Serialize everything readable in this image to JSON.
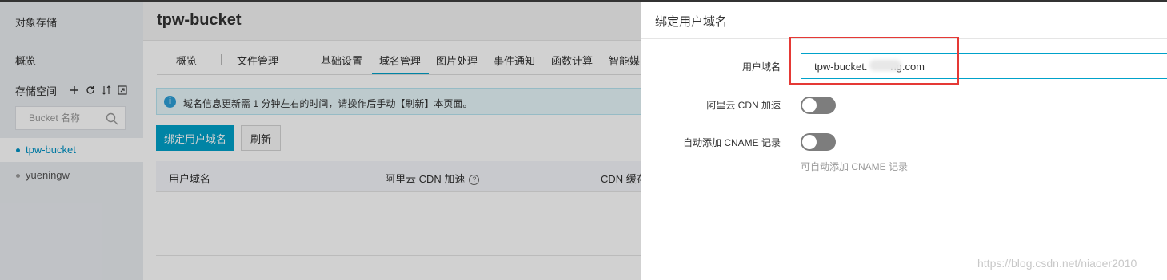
{
  "sidebar": {
    "title": "对象存储",
    "overview": "概览",
    "storage_label": "存储空间",
    "tools": [
      "add-icon",
      "refresh-icon",
      "sort-icon",
      "expand-icon"
    ],
    "search_placeholder": "Bucket 名称",
    "buckets": [
      {
        "name": "tpw-bucket",
        "active": true
      },
      {
        "name": "yueningw",
        "active": false
      }
    ]
  },
  "main": {
    "bucket_title": "tpw-bucket",
    "tabs": [
      "概览",
      "文件管理",
      "基础设置",
      "域名管理",
      "图片处理",
      "事件通知",
      "函数计算",
      "智能媒"
    ],
    "active_tab": "域名管理",
    "notice": "域名信息更新需 1 分钟左右的时间，请操作后手动【刷新】本页面。",
    "bind_button": "绑定用户域名",
    "refresh_button": "刷新",
    "table_headers": [
      "用户域名",
      "阿里云 CDN 加速",
      "CDN 缓存"
    ]
  },
  "panel": {
    "title": "绑定用户域名",
    "domain_label": "用户域名",
    "domain_value": "tpw-bucket.        ng.com",
    "cdn_label": "阿里云 CDN 加速",
    "cname_label": "自动添加 CNAME 记录",
    "cname_help": "可自动添加 CNAME 记录",
    "cdn_enabled": false,
    "cname_enabled": false
  },
  "watermark": "https://blog.csdn.net/niaoer2010",
  "colors": {
    "accent": "#00a2ca",
    "highlight_border": "#e53935"
  }
}
